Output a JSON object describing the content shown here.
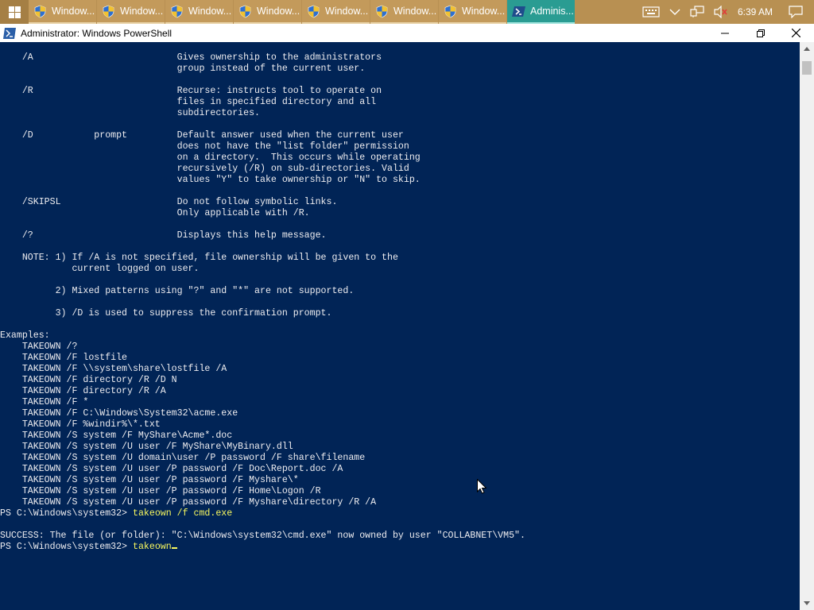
{
  "taskbar": {
    "start_icon": "windows-logo-icon",
    "buttons": [
      {
        "label": "Window...",
        "icon": "uac-shield-icon",
        "active": false
      },
      {
        "label": "Window...",
        "icon": "uac-shield-icon",
        "active": false
      },
      {
        "label": "Window...",
        "icon": "uac-shield-icon",
        "active": false
      },
      {
        "label": "Window...",
        "icon": "uac-shield-icon",
        "active": false
      },
      {
        "label": "Window...",
        "icon": "uac-shield-icon",
        "active": false
      },
      {
        "label": "Window...",
        "icon": "uac-shield-icon",
        "active": false
      },
      {
        "label": "Window...",
        "icon": "uac-shield-icon",
        "active": false
      },
      {
        "label": "Adminis...",
        "icon": "powershell-icon",
        "active": true
      }
    ],
    "tray_icons": [
      "keyboard-icon",
      "chevron-up-icon",
      "network-icon",
      "volume-muted-icon"
    ],
    "clock": "6:39 AM",
    "notification_icon": "action-center-icon"
  },
  "window": {
    "title": "Administrator: Windows PowerShell",
    "controls": [
      "minimize-icon",
      "restore-icon",
      "close-icon"
    ]
  },
  "console": {
    "help_text": "    /A                          Gives ownership to the administrators\n                                group instead of the current user.\n\n    /R                          Recurse: instructs tool to operate on\n                                files in specified directory and all\n                                subdirectories.\n\n    /D           prompt         Default answer used when the current user\n                                does not have the \"list folder\" permission\n                                on a directory.  This occurs while operating\n                                recursively (/R) on sub-directories. Valid\n                                values \"Y\" to take ownership or \"N\" to skip.\n\n    /SKIPSL                     Do not follow symbolic links.\n                                Only applicable with /R.\n\n    /?                          Displays this help message.\n\n    NOTE: 1) If /A is not specified, file ownership will be given to the\n             current logged on user.\n\n          2) Mixed patterns using \"?\" and \"*\" are not supported.\n\n          3) /D is used to suppress the confirmation prompt.\n\nExamples:\n    TAKEOWN /?\n    TAKEOWN /F lostfile\n    TAKEOWN /F \\\\system\\share\\lostfile /A\n    TAKEOWN /F directory /R /D N\n    TAKEOWN /F directory /R /A\n    TAKEOWN /F *\n    TAKEOWN /F C:\\Windows\\System32\\acme.exe\n    TAKEOWN /F %windir%\\*.txt\n    TAKEOWN /S system /F MyShare\\Acme*.doc\n    TAKEOWN /S system /U user /F MyShare\\MyBinary.dll\n    TAKEOWN /S system /U domain\\user /P password /F share\\filename\n    TAKEOWN /S system /U user /P password /F Doc\\Report.doc /A\n    TAKEOWN /S system /U user /P password /F Myshare\\*\n    TAKEOWN /S system /U user /P password /F Home\\Logon /R\n    TAKEOWN /S system /U user /P password /F Myshare\\directory /R /A",
    "prompt1": "PS C:\\Windows\\system32> ",
    "command1": "takeown /f cmd.exe",
    "result": "SUCCESS: The file (or folder): \"C:\\Windows\\system32\\cmd.exe\" now owned by user \"COLLABNET\\VM5\".",
    "prompt2": "PS C:\\Windows\\system32> ",
    "command2": "takeown",
    "text_color": "#eeedf0",
    "command_color": "#f7f75e",
    "background_color": "#012456"
  },
  "scrollbar": {
    "up_icon": "scroll-up-arrow-icon",
    "down_icon": "scroll-down-arrow-icon"
  }
}
